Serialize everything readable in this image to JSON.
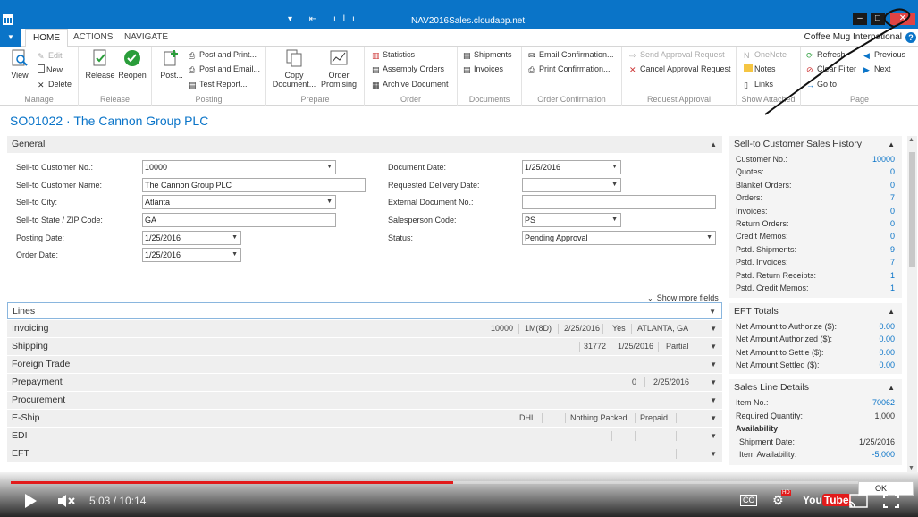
{
  "window": {
    "title": "NAV2016Sales.cloudapp.net",
    "qat_icons": [
      "dropdown-icon",
      "back-icon",
      "chart-icon"
    ],
    "min": "–",
    "max": "□",
    "close": "✕"
  },
  "ribbon_tabs": {
    "file": "▼",
    "tabs": [
      "HOME",
      "ACTIONS",
      "NAVIGATE"
    ],
    "active": "HOME",
    "company": "Coffee Mug International",
    "help": "?"
  },
  "ribbon": {
    "manage": {
      "label": "Manage",
      "view": "View",
      "edit": "Edit",
      "new": "New",
      "delete": "Delete"
    },
    "release": {
      "label": "Release",
      "release": "Release",
      "reopen": "Reopen"
    },
    "posting": {
      "label": "Posting",
      "post": "Post...",
      "post_print": "Post and Print...",
      "post_email": "Post and Email...",
      "test_report": "Test Report..."
    },
    "prepare": {
      "label": "Prepare",
      "copy_doc_1": "Copy",
      "copy_doc_2": "Document...",
      "order_prom_1": "Order",
      "order_prom_2": "Promising"
    },
    "order": {
      "label": "Order",
      "statistics": "Statistics",
      "assembly": "Assembly Orders",
      "archive": "Archive Document"
    },
    "documents": {
      "label": "Documents",
      "shipments": "Shipments",
      "invoices": "Invoices"
    },
    "order_confirmation": {
      "label": "Order Confirmation",
      "email": "Email Confirmation...",
      "print": "Print Confirmation..."
    },
    "request_approval": {
      "label": "Request Approval",
      "send": "Send Approval Request",
      "cancel": "Cancel Approval Request"
    },
    "show_attached": {
      "label": "Show Attached",
      "onenote": "OneNote",
      "notes": "Notes",
      "links": "Links"
    },
    "page": {
      "label": "Page",
      "refresh": "Refresh",
      "clear_filter": "Clear Filter",
      "previous": "Previous",
      "next": "Next",
      "goto": "Go to"
    }
  },
  "page_title": "SO01022 · The Cannon Group PLC",
  "general": {
    "header": "General",
    "fields_left": [
      {
        "label": "Sell-to Customer No.:",
        "value": "10000",
        "dropdown": true
      },
      {
        "label": "Sell-to Customer Name:",
        "value": "The Cannon Group PLC",
        "dropdown": false
      },
      {
        "label": "Sell-to City:",
        "value": "Atlanta",
        "dropdown": true
      },
      {
        "label": "Sell-to State / ZIP Code:",
        "value": "GA",
        "dropdown": false
      },
      {
        "label": "Posting Date:",
        "value": "1/25/2016",
        "dropdown": true
      },
      {
        "label": "Order Date:",
        "value": "1/25/2016",
        "dropdown": true
      }
    ],
    "fields_right": [
      {
        "label": "Document Date:",
        "value": "1/25/2016",
        "dropdown": true
      },
      {
        "label": "Requested Delivery Date:",
        "value": "",
        "dropdown": true
      },
      {
        "label": "External Document No.:",
        "value": "",
        "dropdown": false
      },
      {
        "label": "Salesperson Code:",
        "value": "PS",
        "dropdown": true
      },
      {
        "label": "Status:",
        "value": "Pending Approval",
        "dropdown": true
      }
    ],
    "show_more": "Show more fields"
  },
  "fasttabs": {
    "lines": "Lines",
    "invoicing": {
      "label": "Invoicing",
      "summary": [
        "10000",
        "1M(8D)",
        "2/25/2016",
        "Yes",
        "ATLANTA, GA"
      ]
    },
    "shipping": {
      "label": "Shipping",
      "summary": [
        "31772",
        "1/25/2016",
        "Partial"
      ]
    },
    "foreign_trade": {
      "label": "Foreign Trade"
    },
    "prepayment": {
      "label": "Prepayment",
      "summary": [
        "0",
        "2/25/2016"
      ]
    },
    "procurement": {
      "label": "Procurement"
    },
    "eship": {
      "label": "E-Ship",
      "summary": [
        "DHL",
        "Nothing Packed",
        "Prepaid"
      ]
    },
    "edi": {
      "label": "EDI"
    },
    "eft": {
      "label": "EFT"
    }
  },
  "factbox_history": {
    "header": "Sell-to Customer Sales History",
    "rows": [
      {
        "label": "Customer No.:",
        "value": "10000"
      },
      {
        "label": "Quotes:",
        "value": "0"
      },
      {
        "label": "Blanket Orders:",
        "value": "0"
      },
      {
        "label": "Orders:",
        "value": "7"
      },
      {
        "label": "Invoices:",
        "value": "0"
      },
      {
        "label": "Return Orders:",
        "value": "0"
      },
      {
        "label": "Credit Memos:",
        "value": "0"
      },
      {
        "label": "Pstd. Shipments:",
        "value": "9"
      },
      {
        "label": "Pstd. Invoices:",
        "value": "7"
      },
      {
        "label": "Pstd. Return Receipts:",
        "value": "1"
      },
      {
        "label": "Pstd. Credit Memos:",
        "value": "1"
      }
    ]
  },
  "factbox_eft": {
    "header": "EFT Totals",
    "rows": [
      {
        "label": "Net Amount to Authorize ($):",
        "value": "0.00"
      },
      {
        "label": "Net Amount Authorized ($):",
        "value": "0.00"
      },
      {
        "label": "Net Amount to Settle ($):",
        "value": "0.00"
      },
      {
        "label": "Net Amount Settled ($):",
        "value": "0.00"
      }
    ]
  },
  "factbox_sales_line": {
    "header": "Sales Line Details",
    "item_no_label": "Item No.:",
    "item_no": "70062",
    "req_qty_label": "Required Quantity:",
    "req_qty": "1,000",
    "availability": "Availability",
    "shipment_date_label": "Shipment Date:",
    "shipment_date": "1/25/2016",
    "item_avail_label": "Item Availability:",
    "item_avail": "-5,000"
  },
  "video": {
    "time": "5:03 / 10:14",
    "progress_fraction": 0.494,
    "ok": "OK",
    "cc": "CC",
    "hd": "HD"
  },
  "colors": {
    "accent": "#0a74c8",
    "close": "#e04343",
    "progress": "#e21b1b"
  }
}
